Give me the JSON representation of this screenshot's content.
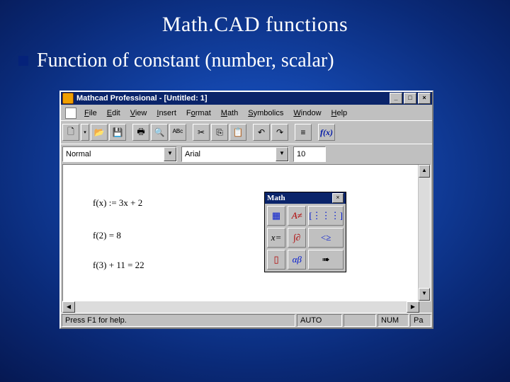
{
  "slide": {
    "title": "Math.CAD functions",
    "subtitle": "Function of constant (number, scalar)"
  },
  "window": {
    "title": "Mathcad Professional - [Untitled: 1]",
    "buttons": {
      "min": "_",
      "max": "□",
      "close": "×"
    }
  },
  "menu": {
    "file": "File",
    "edit": "Edit",
    "view": "View",
    "insert": "Insert",
    "format": "Format",
    "math": "Math",
    "symbolics": "Symbolics",
    "window": "Window",
    "help": "Help"
  },
  "toolbar": {
    "new": "🗋",
    "open": "📂",
    "save": "💾",
    "print": "🖶",
    "preview": "🔍",
    "spell": "ᴬᴮᶜ",
    "cut": "✂",
    "copy": "⎘",
    "paste": "📋",
    "undo": "↶",
    "redo": "↷",
    "align": "≡",
    "fx": "f(x)"
  },
  "format_bar": {
    "style": "Normal",
    "font": "Arial",
    "size": "10"
  },
  "equations": {
    "eq1": "f(x) := 3x + 2",
    "eq2": "f(2) = 8",
    "eq3": "f(3) + 11 = 22"
  },
  "palette": {
    "title": "Math",
    "btns": {
      "calc": "▦",
      "graph": "A≠",
      "matrix": "[⋮⋮⋮]",
      "eval": "x=",
      "calc2": "∫∂",
      "bool": "<≥",
      "prog": "▯",
      "greek": "αβ",
      "sym": "➠"
    }
  },
  "status": {
    "help": "Press F1 for help.",
    "auto": "AUTO",
    "num": "NUM",
    "page": "Pa"
  }
}
